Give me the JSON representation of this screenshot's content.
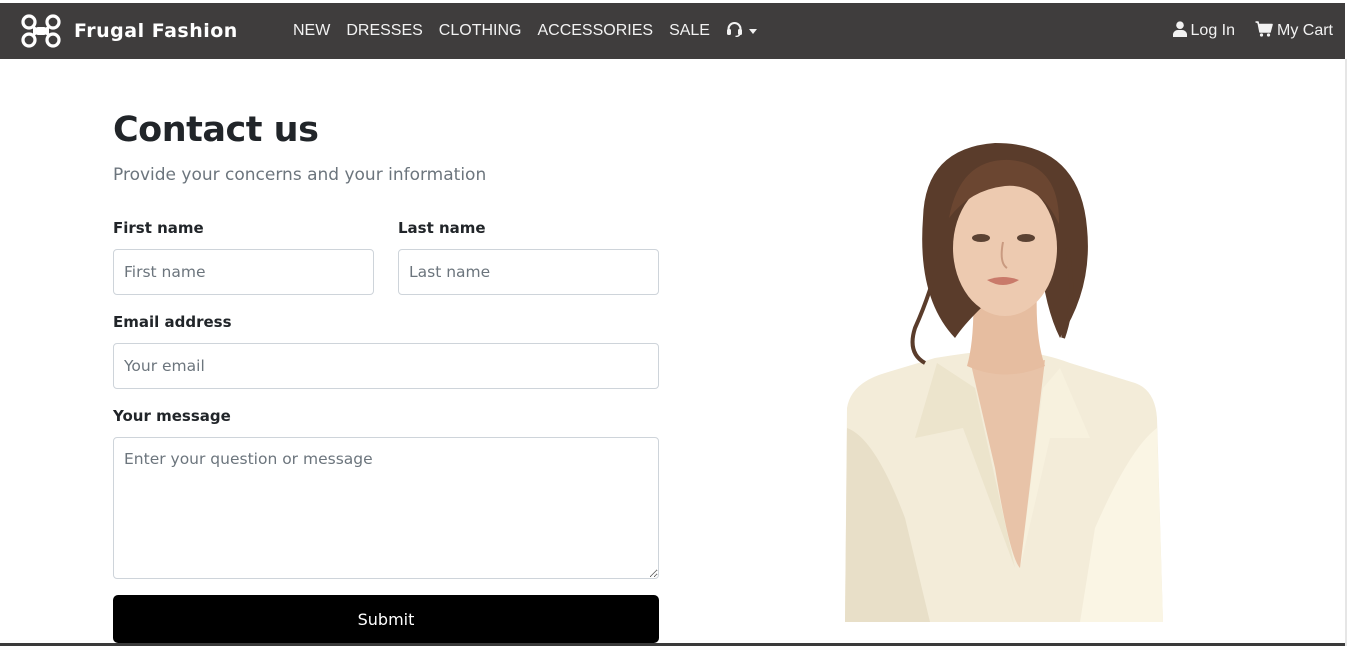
{
  "navbar": {
    "brand": "Frugal Fashion",
    "brand_icon": "drone-icon",
    "links": [
      "NEW",
      "DRESSES",
      "CLOTHING",
      "ACCESSORIES",
      "SALE"
    ],
    "support_icon": "headset-icon",
    "login_label": "Log In",
    "cart_label": "My Cart"
  },
  "page": {
    "title": "Contact us",
    "subtitle": "Provide your concerns and your information"
  },
  "form": {
    "first_name_label": "First name",
    "first_name_placeholder": "First name",
    "last_name_label": "Last name",
    "last_name_placeholder": "Last name",
    "email_label": "Email address",
    "email_placeholder": "Your email",
    "message_label": "Your message",
    "message_placeholder": "Enter your question or message",
    "submit_label": "Submit"
  },
  "colors": {
    "navbar_bg": "#3f3d3d",
    "submit_bg": "#000000"
  }
}
